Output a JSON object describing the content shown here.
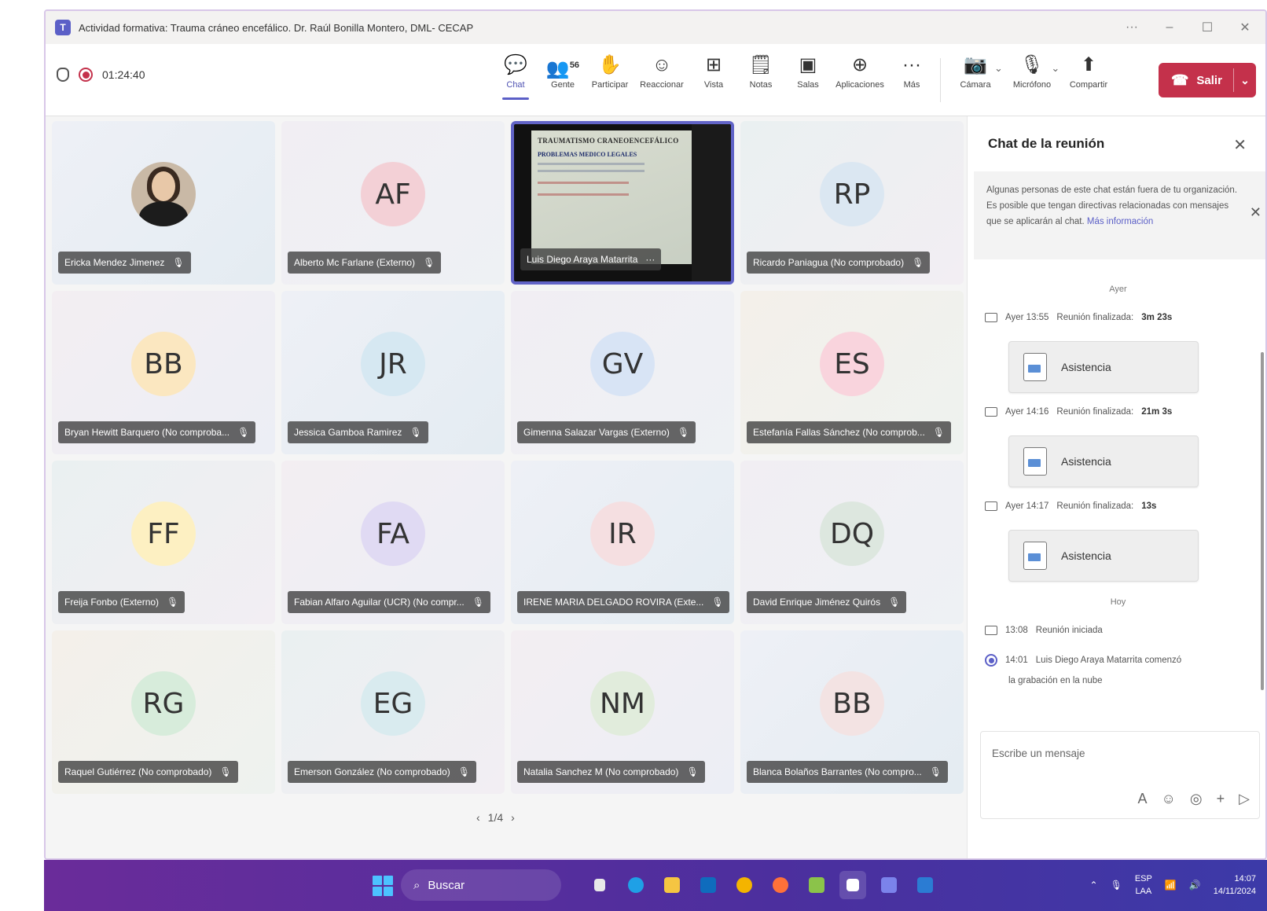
{
  "window": {
    "title": "Actividad formativa: Trauma cráneo encefálico. Dr. Raúl Bonilla Montero, DML- CECAP",
    "controls": [
      "···",
      "–",
      "☐",
      "✕"
    ]
  },
  "toolbar": {
    "timer": "01:24:40",
    "people_count": "56",
    "buttons": [
      {
        "label": "Chat",
        "icon": "chat-icon",
        "glyph": "💬"
      },
      {
        "label": "Gente",
        "icon": "people-icon",
        "glyph": "👥"
      },
      {
        "label": "Participar",
        "icon": "raise-hand-icon",
        "glyph": "✋"
      },
      {
        "label": "Reaccionar",
        "icon": "smiley-icon",
        "glyph": "☺"
      },
      {
        "label": "Vista",
        "icon": "grid-view-icon",
        "glyph": "⊞"
      },
      {
        "label": "Notas",
        "icon": "notes-icon",
        "glyph": "🗒"
      },
      {
        "label": "Salas",
        "icon": "rooms-icon",
        "glyph": "▣"
      },
      {
        "label": "Aplicaciones",
        "icon": "apps-plus-icon",
        "glyph": "⊕"
      },
      {
        "label": "Más",
        "icon": "more-icon",
        "glyph": "···"
      }
    ],
    "media": [
      {
        "label": "Cámara",
        "icon": "camera-off-icon",
        "glyph": "📷"
      },
      {
        "label": "Micrófono",
        "icon": "mic-off-icon",
        "glyph": "🎙"
      },
      {
        "label": "Compartir",
        "icon": "share-icon",
        "glyph": "⬆"
      }
    ],
    "leave_label": "Salir"
  },
  "participants": [
    {
      "name": "Ericka Mendez Jimenez",
      "initials": "",
      "photo": true,
      "avatar_color": "#c9b9a6"
    },
    {
      "name": "Alberto Mc Farlane (Externo)",
      "initials": "AF",
      "avatar_color": "#f3d0d6"
    },
    {
      "name": "Luis Diego Araya Matarrita",
      "initials": "",
      "presenting": true
    },
    {
      "name": "Ricardo Paniagua (No comprobado)",
      "initials": "RP",
      "avatar_color": "#dbe7f2"
    },
    {
      "name": "Bryan Hewitt Barquero (No comproba...",
      "initials": "BB",
      "avatar_color": "#fbe7c0"
    },
    {
      "name": "Jessica Gamboa Ramirez",
      "initials": "JR",
      "avatar_color": "#d6e8f2"
    },
    {
      "name": "Gimenna Salazar Vargas (Externo)",
      "initials": "GV",
      "avatar_color": "#d8e4f5"
    },
    {
      "name": "Estefanía Fallas Sánchez (No comprob...",
      "initials": "ES",
      "avatar_color": "#f9d4dd"
    },
    {
      "name": "Freija Fonbo (Externo)",
      "initials": "FF",
      "avatar_color": "#fdf0c2"
    },
    {
      "name": "Fabian Alfaro Aguilar (UCR) (No compr...",
      "initials": "FA",
      "avatar_color": "#e0daf3"
    },
    {
      "name": "IRENE MARIA DELGADO ROVIRA (Exte...",
      "initials": "IR",
      "avatar_color": "#f5dfe1"
    },
    {
      "name": "David Enrique Jiménez Quirós",
      "initials": "DQ",
      "avatar_color": "#dde7df"
    },
    {
      "name": "Raquel Gutiérrez (No comprobado)",
      "initials": "RG",
      "avatar_color": "#d7ecdb"
    },
    {
      "name": "Emerson González (No comprobado)",
      "initials": "EG",
      "avatar_color": "#d9ebef"
    },
    {
      "name": "Natalia Sanchez M (No comprobado)",
      "initials": "NM",
      "avatar_color": "#e1ecdc"
    },
    {
      "name": "Blanca Bolaños Barrantes (No compro...",
      "initials": "BB",
      "avatar_color": "#f3e3e3"
    }
  ],
  "slide": {
    "title": "TRAUMATISMO CRANEOENCEFÁLICO",
    "subtitle": "PROBLEMAS MEDICO LEGALES"
  },
  "pager": {
    "prev": "‹",
    "label": "1/4",
    "next": "›"
  },
  "chat": {
    "title": "Chat de la reunión",
    "notice": "Algunas personas de este chat están fuera de tu organización. Es posible que tengan directivas relacionadas con mensajes que se aplicarán al chat.",
    "notice_link": "Más información",
    "day_yesterday": "Ayer",
    "events": [
      {
        "time": "Ayer 13:55",
        "text": "Reunión finalizada:",
        "duration": "3m 23s",
        "card": "Asistencia"
      },
      {
        "time": "Ayer 14:16",
        "text": "Reunión finalizada:",
        "duration": "21m 3s",
        "card": "Asistencia"
      },
      {
        "time": "Ayer 14:17",
        "text": "Reunión finalizada:",
        "duration": "13s",
        "card": "Asistencia"
      }
    ],
    "day_today": "Hoy",
    "started": {
      "time": "13:08",
      "text": "Reunión iniciada"
    },
    "recording": {
      "time": "14:01",
      "text": "Luis Diego Araya Matarrita comenzó",
      "text2": "la grabación en la nube"
    },
    "compose_placeholder": "Escribe un mensaje"
  },
  "taskbar": {
    "search_label": "Buscar",
    "lang_top": "ESP",
    "lang_bottom": "LAA",
    "time": "14:07",
    "date": "14/11/2024"
  }
}
